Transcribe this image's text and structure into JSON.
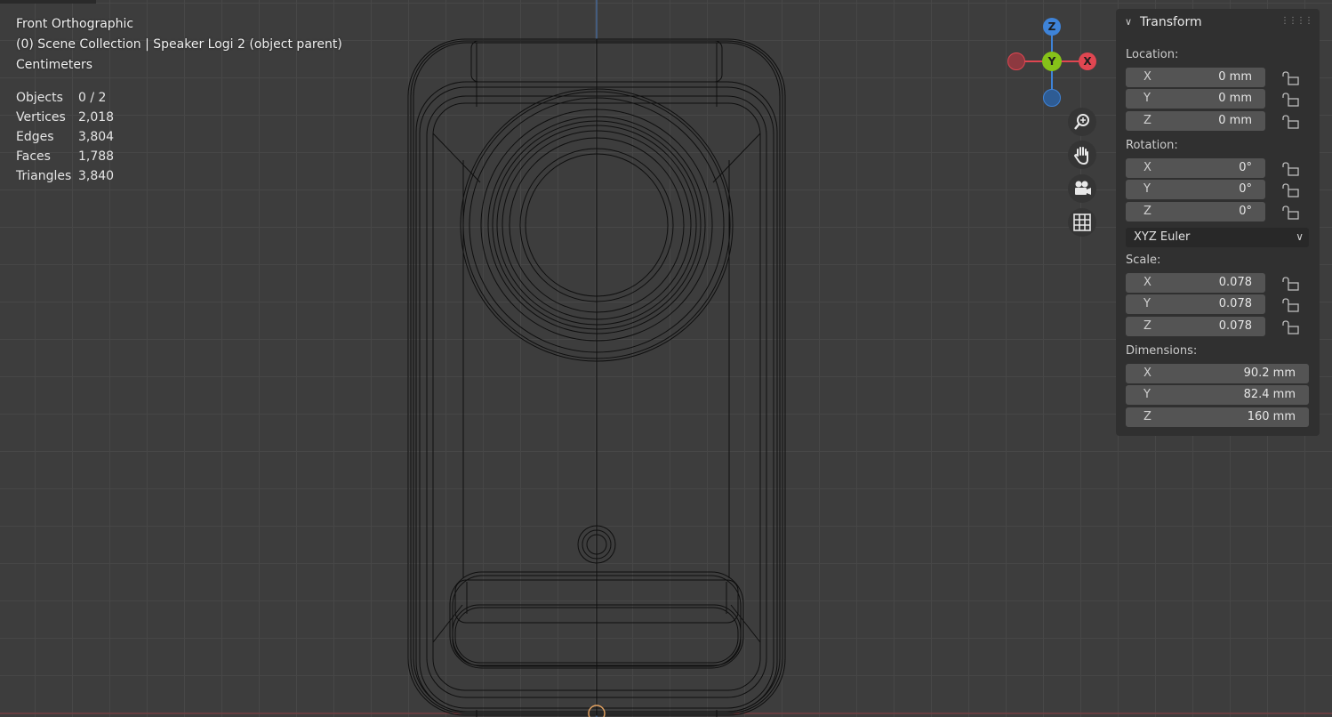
{
  "viewport": {
    "view_name": "Front Orthographic",
    "collection_line": "(0) Scene Collection | Speaker Logi 2 (object parent)",
    "units": "Centimeters"
  },
  "stats": [
    {
      "label": "Objects",
      "value": "0 / 2"
    },
    {
      "label": "Vertices",
      "value": "2,018"
    },
    {
      "label": "Edges",
      "value": "3,804"
    },
    {
      "label": "Faces",
      "value": "1,788"
    },
    {
      "label": "Triangles",
      "value": "3,840"
    }
  ],
  "gizmo": {
    "z": "Z",
    "y": "Y",
    "x": "X"
  },
  "nav_icons": [
    "zoom-icon",
    "hand-pan-icon",
    "camera-icon",
    "grid-icon"
  ],
  "panel": {
    "title": "Transform",
    "location": {
      "label": "Location:",
      "fields": [
        {
          "axis": "X",
          "value": "0 mm"
        },
        {
          "axis": "Y",
          "value": "0 mm"
        },
        {
          "axis": "Z",
          "value": "0 mm"
        }
      ]
    },
    "rotation": {
      "label": "Rotation:",
      "fields": [
        {
          "axis": "X",
          "value": "0°"
        },
        {
          "axis": "Y",
          "value": "0°"
        },
        {
          "axis": "Z",
          "value": "0°"
        }
      ],
      "mode": "XYZ Euler"
    },
    "scale": {
      "label": "Scale:",
      "fields": [
        {
          "axis": "X",
          "value": "0.078"
        },
        {
          "axis": "Y",
          "value": "0.078"
        },
        {
          "axis": "Z",
          "value": "0.078"
        }
      ]
    },
    "dimensions": {
      "label": "Dimensions:",
      "fields": [
        {
          "axis": "X",
          "value": "90.2 mm"
        },
        {
          "axis": "Y",
          "value": "82.4 mm"
        },
        {
          "axis": "Z",
          "value": "160 mm"
        }
      ]
    }
  },
  "colors": {
    "x_axis": "#e04651",
    "y_axis": "#86c219",
    "z_axis": "#3e83d8",
    "field_bg": "#545454",
    "panel_bg": "#303030"
  }
}
